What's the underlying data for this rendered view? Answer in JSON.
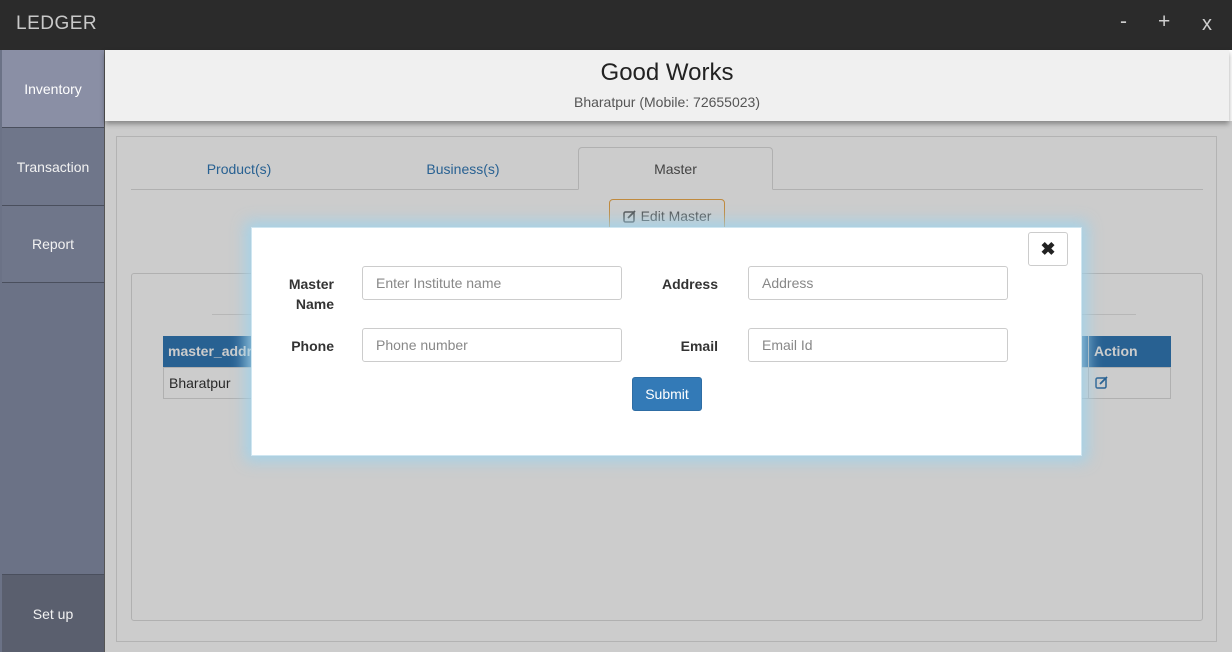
{
  "app": {
    "title": "LEDGER",
    "window_controls": {
      "minimize": "-",
      "maximize": "+",
      "close": "x"
    }
  },
  "sidebar": {
    "items": [
      {
        "label": "Inventory",
        "active": true
      },
      {
        "label": "Transaction"
      },
      {
        "label": "Report"
      },
      {
        "label": "Set up"
      }
    ]
  },
  "header": {
    "business_name": "Good Works",
    "subtitle": "Bharatpur (Mobile: 72655023)"
  },
  "tabs": [
    {
      "label": "Product(s)"
    },
    {
      "label": "Business(s)"
    },
    {
      "label": "Master",
      "active": true
    }
  ],
  "master": {
    "edit_button_label": "Edit Master",
    "table": {
      "columns": [
        "master_address",
        "Action"
      ],
      "rows": [
        {
          "master_address": "Bharatpur",
          "action_icon": "edit-icon"
        }
      ]
    }
  },
  "modal": {
    "close_icon": "✖",
    "fields": {
      "master_name": {
        "label": "Master Name",
        "placeholder": "Enter Institute name",
        "value": ""
      },
      "address": {
        "label": "Address",
        "placeholder": "Address",
        "value": ""
      },
      "phone": {
        "label": "Phone",
        "placeholder": "Phone number",
        "value": ""
      },
      "email": {
        "label": "Email",
        "placeholder": "Email Id",
        "value": ""
      }
    },
    "submit_label": "Submit"
  },
  "colors": {
    "primary": "#337ab7",
    "warning_border": "#f0ad4e",
    "titlebar": "#2b2b2b",
    "sidebar": "#6b7286"
  }
}
